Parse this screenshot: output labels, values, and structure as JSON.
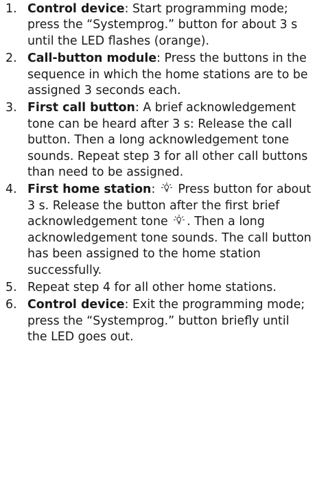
{
  "steps": [
    {
      "num": "1.",
      "lead": "Control device",
      "text": ": Start programming mode; press the “Systemprog.” button for about 3 s until the LED flashes (orange)."
    },
    {
      "num": "2.",
      "lead": "Call-button module",
      "text": ": Press the buttons in the sequence in which the home stations are to be assigned 3 seconds each."
    },
    {
      "num": "3.",
      "lead": "First call button",
      "text": ": A brief acknowledgement tone can be heard after 3 s: Release the call button. Then a long acknowledgement tone sounds. Repeat step 3 for all other call buttons than need to be assigned."
    },
    {
      "num": "4.",
      "lead": "First home station",
      "text_a": ": ",
      "text_b": " Press button for about 3 s. Release the button after the first brief acknowledgement tone ",
      "text_c": ". Then a long acknowledgement tone sounds. The call button has been assigned to the home station successfully.",
      "icon": "lightbulb-icon"
    },
    {
      "num": "5.",
      "lead": "",
      "text": "Repeat step 4 for all other home stations."
    },
    {
      "num": "6.",
      "lead": "Control device",
      "text": ": Exit the programming mode; press the “Systemprog.” button briefly until the LED goes out."
    }
  ]
}
